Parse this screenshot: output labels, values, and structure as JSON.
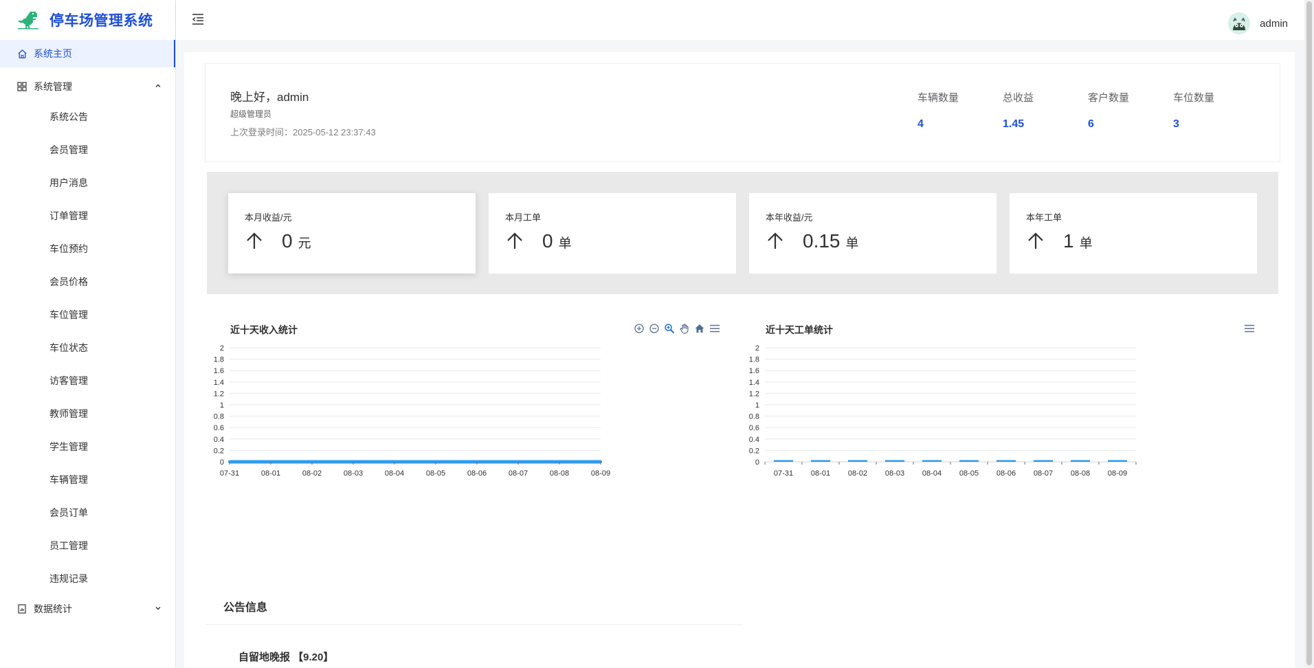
{
  "app": {
    "title": "停车场管理系统",
    "colors": {
      "brand": "#1f4fd6",
      "chart_bar": "#2f9bee",
      "active_bg": "#ecf2ff"
    }
  },
  "sidebar": {
    "home": {
      "label": "系统主页",
      "icon": "home-icon"
    },
    "system": {
      "label": "系统管理",
      "icon": "grid-icon",
      "expanded": true,
      "items": [
        {
          "label": "系统公告"
        },
        {
          "label": "会员管理"
        },
        {
          "label": "用户消息"
        },
        {
          "label": "订单管理"
        },
        {
          "label": "车位预约"
        },
        {
          "label": "会员价格"
        },
        {
          "label": "车位管理"
        },
        {
          "label": "车位状态"
        },
        {
          "label": "访客管理"
        },
        {
          "label": "教师管理"
        },
        {
          "label": "学生管理"
        },
        {
          "label": "车辆管理"
        },
        {
          "label": "会员订单"
        },
        {
          "label": "员工管理"
        },
        {
          "label": "违规记录"
        }
      ]
    },
    "stats": {
      "label": "数据统计",
      "icon": "report-icon",
      "expanded": false
    }
  },
  "header": {
    "username": "admin",
    "collapse_icon": "menu-fold-icon"
  },
  "welcome": {
    "greeting": "晚上好，admin",
    "role": "超级管理员",
    "last_login": "上次登录时间：2025-05-12 23:37:43",
    "stats": [
      {
        "label": "车辆数量",
        "value": "4"
      },
      {
        "label": "总收益",
        "value": "1.45"
      },
      {
        "label": "客户数量",
        "value": "6"
      },
      {
        "label": "车位数量",
        "value": "3"
      }
    ]
  },
  "cards": [
    {
      "title": "本月收益/元",
      "value": "0",
      "unit": "元"
    },
    {
      "title": "本月工单",
      "value": "0",
      "unit": "单"
    },
    {
      "title": "本年收益/元",
      "value": "0.15",
      "unit": "单"
    },
    {
      "title": "本年工单",
      "value": "1",
      "unit": "单"
    }
  ],
  "chart_data": [
    {
      "type": "line",
      "title": "近十天收入统计",
      "categories": [
        "07-31",
        "08-01",
        "08-02",
        "08-03",
        "08-04",
        "08-05",
        "08-06",
        "08-07",
        "08-08",
        "08-09"
      ],
      "values": [
        0,
        0,
        0,
        0,
        0,
        0,
        0,
        0,
        0,
        0
      ],
      "ylim": [
        0,
        2
      ],
      "yticks": [
        "0",
        "0.2",
        "0.4",
        "0.6",
        "0.8",
        "1",
        "1.2",
        "1.4",
        "1.6",
        "1.8",
        "2"
      ],
      "grid": true,
      "toolbox": [
        "zoom-in-icon",
        "zoom-out-icon",
        "magnify-icon",
        "pan-icon",
        "reset-home-icon",
        "menu-icon"
      ]
    },
    {
      "type": "bar",
      "title": "近十天工单统计",
      "categories": [
        "07-31",
        "08-01",
        "08-02",
        "08-03",
        "08-04",
        "08-05",
        "08-06",
        "08-07",
        "08-08",
        "08-09"
      ],
      "values": [
        0,
        0,
        0,
        0,
        0,
        0,
        0,
        0,
        0,
        0
      ],
      "ylim": [
        0,
        2
      ],
      "yticks": [
        "0",
        "0.2",
        "0.4",
        "0.6",
        "0.8",
        "1",
        "1.2",
        "1.4",
        "1.6",
        "1.8",
        "2"
      ],
      "grid": true,
      "toolbox": [
        "menu-icon"
      ]
    }
  ],
  "notice": {
    "title": "公告信息",
    "items": [
      {
        "label": "自留地晚报 【9.20】"
      }
    ]
  }
}
